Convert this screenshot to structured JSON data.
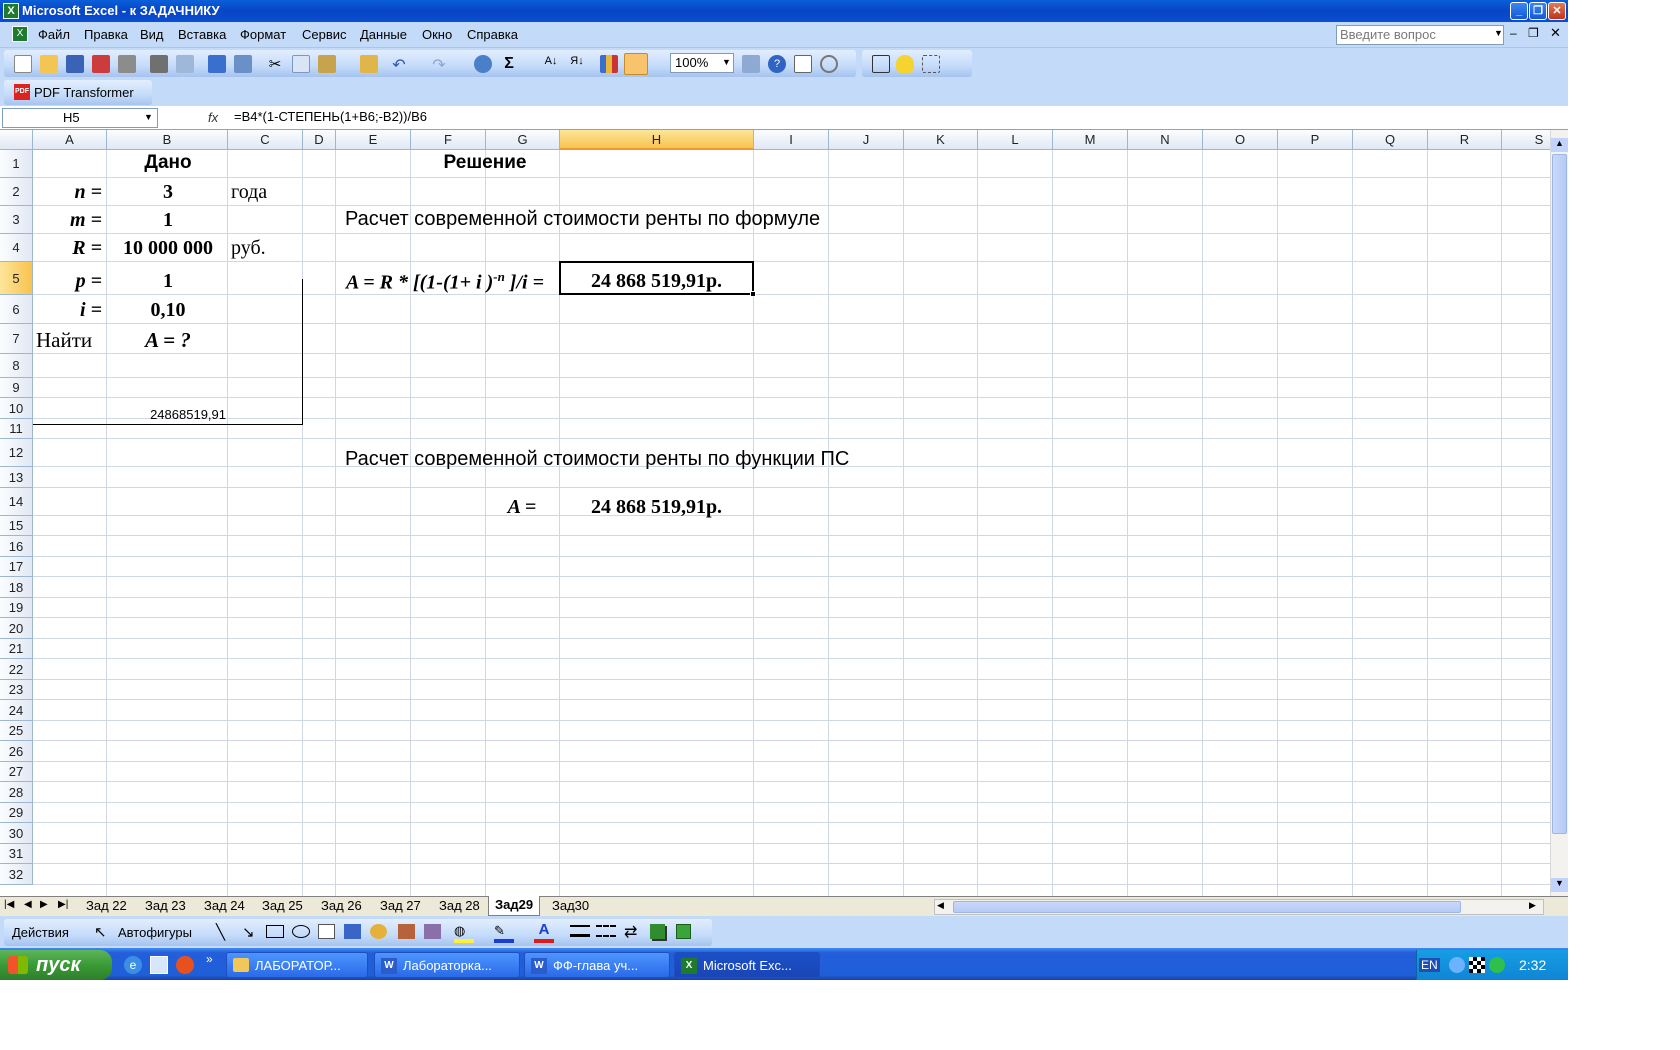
{
  "window": {
    "title": "Microsoft Excel - к ЗАДАЧНИКУ"
  },
  "menu": {
    "items": [
      "Файл",
      "Правка",
      "Вид",
      "Вставка",
      "Формат",
      "Сервис",
      "Данные",
      "Окно",
      "Справка"
    ],
    "help_placeholder": "Введите вопрос"
  },
  "toolbar": {
    "zoom": "100%"
  },
  "pdfbar": {
    "label": "PDF Transformer",
    "icon_text": "PDF"
  },
  "formula": {
    "name_box": "H5",
    "fx": "fx",
    "text": "=B4*(1-СТЕПЕНЬ(1+B6;-B2))/B6"
  },
  "columns": [
    "A",
    "B",
    "C",
    "D",
    "E",
    "F",
    "G",
    "H",
    "I",
    "J",
    "K",
    "L",
    "M",
    "N",
    "O",
    "P",
    "Q",
    "R",
    "S"
  ],
  "rows": [
    "1",
    "2",
    "3",
    "4",
    "5",
    "6",
    "7",
    "8",
    "9",
    "10",
    "11",
    "12",
    "13",
    "14",
    "15",
    "16",
    "17",
    "18",
    "19",
    "20",
    "21",
    "22",
    "23",
    "24",
    "25",
    "26",
    "27",
    "28",
    "29",
    "30",
    "31",
    "32"
  ],
  "sheet": {
    "given_title": "Дано",
    "solution_title": "Решение",
    "n_label": "n =",
    "n_value": "3",
    "n_unit": "года",
    "m_label": "m =",
    "m_value": "1",
    "R_label": "R =",
    "R_value": "10 000 000",
    "R_unit": "руб.",
    "p_label": "p =",
    "p_value": "1",
    "i_label": "i =",
    "i_value": "0,10",
    "find_label": "Найти",
    "find_value": "A = ?",
    "b10_value": "24868519,91",
    "formula_heading": "Расчет современной стоимости ренты по формуле",
    "formula_expr_a": "A = R * [(1-(1+ i )",
    "formula_expr_exp": "-n",
    "formula_expr_b": " ]/i =",
    "result_formula": "24 868 519,91р.",
    "function_heading": "Расчет современной стоимости ренты по функции ПС",
    "a_eq": "A  =",
    "result_function": "24 868 519,91р."
  },
  "sheet_tabs": [
    "Зад 22",
    "Зад 23",
    "Зад 24",
    "Зад 25",
    "Зад 26",
    "Зад 27",
    "Зад 28",
    "Зад29",
    "Зад30"
  ],
  "active_tab": "Зад29",
  "drawbar": {
    "actions": "Действия",
    "autoshapes": "Автофигуры"
  },
  "taskbar": {
    "start": "пуск",
    "tasks": [
      "ЛАБОРАТОР...",
      "Лабораторка...",
      "ФФ-глава уч...",
      "Microsoft Exc..."
    ],
    "lang": "EN",
    "clock": "2:32"
  }
}
